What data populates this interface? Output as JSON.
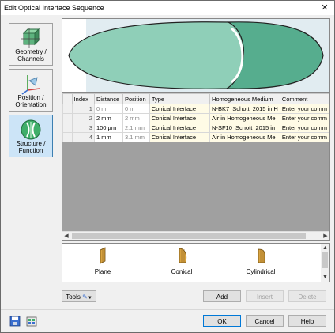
{
  "window": {
    "title": "Edit Optical Interface Sequence",
    "close_glyph": "✕"
  },
  "sidebar": {
    "items": [
      {
        "label_line1": "Geometry /",
        "label_line2": "Channels",
        "icon": "geometry-cube-icon",
        "selected": false
      },
      {
        "label_line1": "Position /",
        "label_line2": "Orientation",
        "icon": "axes-position-icon",
        "selected": false
      },
      {
        "label_line1": "Structure /",
        "label_line2": "Function",
        "icon": "lens-structure-icon",
        "selected": true
      }
    ]
  },
  "table": {
    "headers": [
      "Index",
      "Distance",
      "Position",
      "Type",
      "Homogeneous Medium",
      "Comment"
    ],
    "rows": [
      {
        "index": "1",
        "distance": "0 m",
        "position": "0 m",
        "type": "Conical Interface",
        "medium": "N-BK7_Schott_2015 in H",
        "comment": "Enter your comm"
      },
      {
        "index": "2",
        "distance": "2 mm",
        "position": "2 mm",
        "type": "Conical Interface",
        "medium": "Air in Homogeneous Me",
        "comment": "Enter your comm"
      },
      {
        "index": "3",
        "distance": "100 µm",
        "position": "2.1 mm",
        "type": "Conical Interface",
        "medium": "N-SF10_Schott_2015 in",
        "comment": "Enter your comm"
      },
      {
        "index": "4",
        "distance": "1 mm",
        "position": "3.1 mm",
        "type": "Conical Interface",
        "medium": "Air in Homogeneous Me",
        "comment": "Enter your comm"
      }
    ]
  },
  "palette": {
    "items": [
      {
        "label": "Plane",
        "icon": "plane-interface-icon"
      },
      {
        "label": "Conical",
        "icon": "conical-interface-icon"
      },
      {
        "label": "Cylindrical",
        "icon": "cylindrical-interface-icon"
      }
    ]
  },
  "buttons": {
    "tools": "Tools",
    "add": "Add",
    "insert": "Insert",
    "delete": "Delete",
    "ok": "OK",
    "cancel": "Cancel",
    "help": "Help"
  },
  "colors": {
    "lens_fill": "#8fcfb8",
    "lens_fill_dark": "#56ad8e",
    "preview_bg": "#a8c8d8",
    "selected_bg": "#cce4f7"
  }
}
